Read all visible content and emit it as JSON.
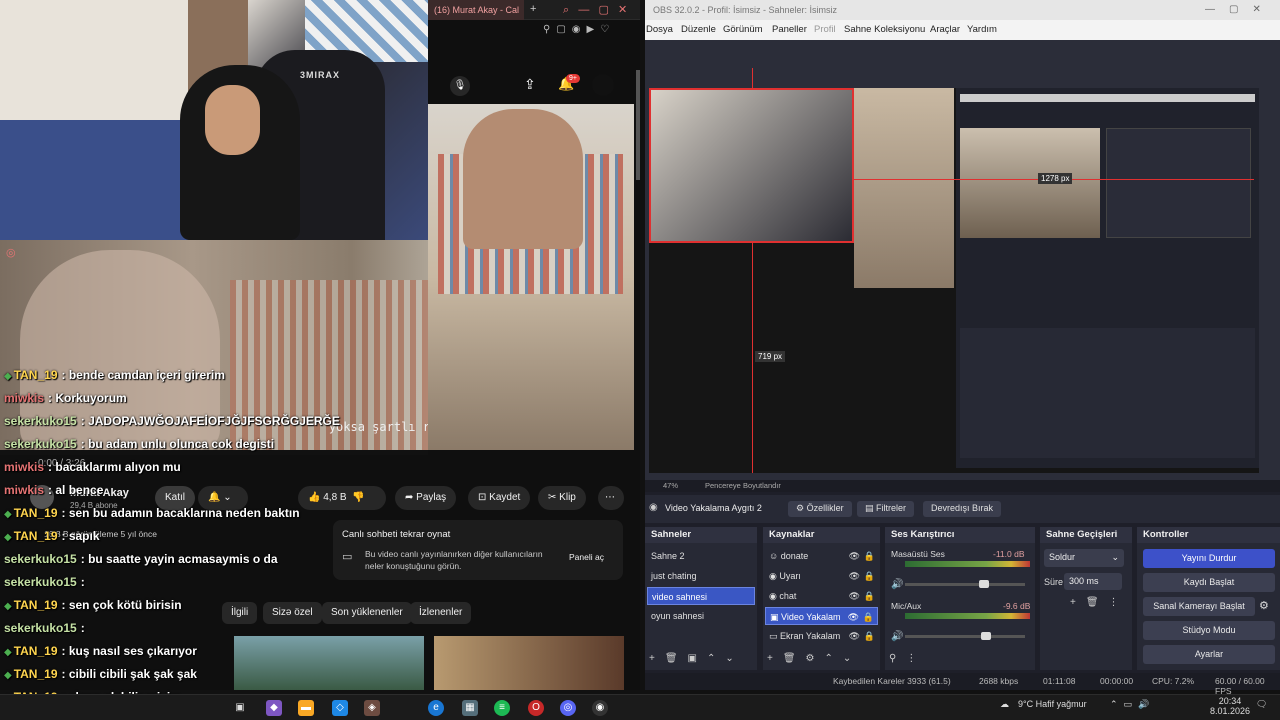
{
  "webcam": {
    "chair_brand": "3MIRAX"
  },
  "bigvideo": {
    "subtitle": "yoksa şartlı refleks mi"
  },
  "browser": {
    "tab_title": "(16) Murat Akay - Cal",
    "notif_count": "9+"
  },
  "chat": [
    {
      "user": "TAN_19",
      "color": "#ffd54f",
      "gem": true,
      "msg": ": bende camdan içeri girerim"
    },
    {
      "user": "miwkis",
      "color": "#e57373",
      "gem": false,
      "msg": ": Korkuyorum"
    },
    {
      "user": "sekerkuko15",
      "color": "#c5e1a5",
      "gem": false,
      "msg": ": JADOPAJWĞOJAFEİOFJĞJFSGRĞGJERĞE"
    },
    {
      "user": "sekerkuko15",
      "color": "#c5e1a5",
      "gem": false,
      "msg": ": bu adam unlu olunca cok degisti"
    },
    {
      "user": "miwkis",
      "color": "#e57373",
      "gem": false,
      "msg": ": bacaklarımı alıyon mu"
    },
    {
      "user": "miwkis",
      "color": "#e57373",
      "gem": false,
      "msg": ": al bence"
    },
    {
      "user": "TAN_19",
      "color": "#ffd54f",
      "gem": true,
      "msg": ": sen bu adamın bacaklarına neden baktın"
    },
    {
      "user": "TAN_19",
      "color": "#ffd54f",
      "gem": true,
      "msg": ": sapık"
    },
    {
      "user": "sekerkuko15",
      "color": "#c5e1a5",
      "gem": false,
      "msg": ": bu saatte yayin acmasaymis o da"
    },
    {
      "user": "sekerkuko15",
      "color": "#c5e1a5",
      "gem": false,
      "msg": ":"
    },
    {
      "user": "TAN_19",
      "color": "#ffd54f",
      "gem": true,
      "msg": ": sen çok kötü birisin"
    },
    {
      "user": "sekerkuko15",
      "color": "#c5e1a5",
      "gem": false,
      "msg": ":"
    },
    {
      "user": "TAN_19",
      "color": "#ffd54f",
      "gem": true,
      "msg": ": kuş nasıl ses çıkarıyor"
    },
    {
      "user": "TAN_19",
      "color": "#ffd54f",
      "gem": true,
      "msg": ": cibili cibili şak şak şak"
    },
    {
      "user": "TAN_19",
      "color": "#ffd54f",
      "gem": true,
      "msg": ": ekran alabilir miyim"
    }
  ],
  "yt": {
    "channel": "Murat Akay",
    "subs": "29,4 B abone",
    "join": "Katıl",
    "likes": "4,8 B",
    "share": "Paylaş",
    "save": "Kaydet",
    "clip": "Klip",
    "views": "16,8 B görüntüleme  5 yıl önce",
    "live_title": "Canlı sohbeti tekrar oynat",
    "live_desc": "Bu video canlı yayınlanırken diğer kullanıcıların neler konuştuğunu görün.",
    "open_panel": "Paneli aç",
    "chips": [
      "İlgili",
      "Sizə özel",
      "Son yüklenenler",
      "İzlenenler"
    ]
  },
  "obs": {
    "title": "OBS 32.0.2 - Profil: İsimsiz - Sahneler: İsimsiz",
    "menu": [
      "Dosya",
      "Düzenle",
      "Görünüm",
      "Paneller",
      "Profil",
      "Sahne Koleksiyonu",
      "Araçlar",
      "Yardım"
    ],
    "dim_w": "1278 px",
    "dim_h": "719 px",
    "zoom": "47%",
    "fit": "Pencereye Boyutlandır",
    "source_name": "Video Yakalama Aygıtı 2",
    "properties": "Özellikler",
    "filters": "Filtreler",
    "deactivate": "Devredışı Bırak",
    "scenes_title": "Sahneler",
    "scenes": [
      "Sahne 2",
      "just chating",
      "video sahnesi",
      "oyun sahnesi"
    ],
    "selected_scene": 2,
    "sources_title": "Kaynaklar",
    "sources": [
      "donate",
      "Uyarı",
      "chat",
      "Video Yakalam",
      "Ekran Yakalam"
    ],
    "selected_source": 3,
    "mixer_title": "Ses Karıştırıcı",
    "desktop_audio": "Masaüstü Ses",
    "desktop_db": "-11.0 dB",
    "mic": "Mic/Aux",
    "mic_db": "-9.6 dB",
    "transitions_title": "Sahne Geçişleri",
    "transition": "Soldur",
    "duration_label": "Süre",
    "duration": "300 ms",
    "controls_title": "Kontroller",
    "controls": [
      "Yayını Durdur",
      "Kaydı Başlat",
      "Sanal Kamerayı Başlat",
      "Stüdyo Modu",
      "Ayarlar"
    ],
    "status": {
      "dropped": "Kaybedilen Kareler 3933 (61.5)",
      "kbps": "2688 kbps",
      "live": "01:11:08",
      "rec": "00:00:00",
      "cpu": "CPU: 7.2%",
      "fps": "60.00 / 60.00 FPS"
    }
  },
  "taskbar": {
    "weather": "9°C  Hafif yağmur",
    "time": "20:34",
    "date": "8.01.2026"
  }
}
